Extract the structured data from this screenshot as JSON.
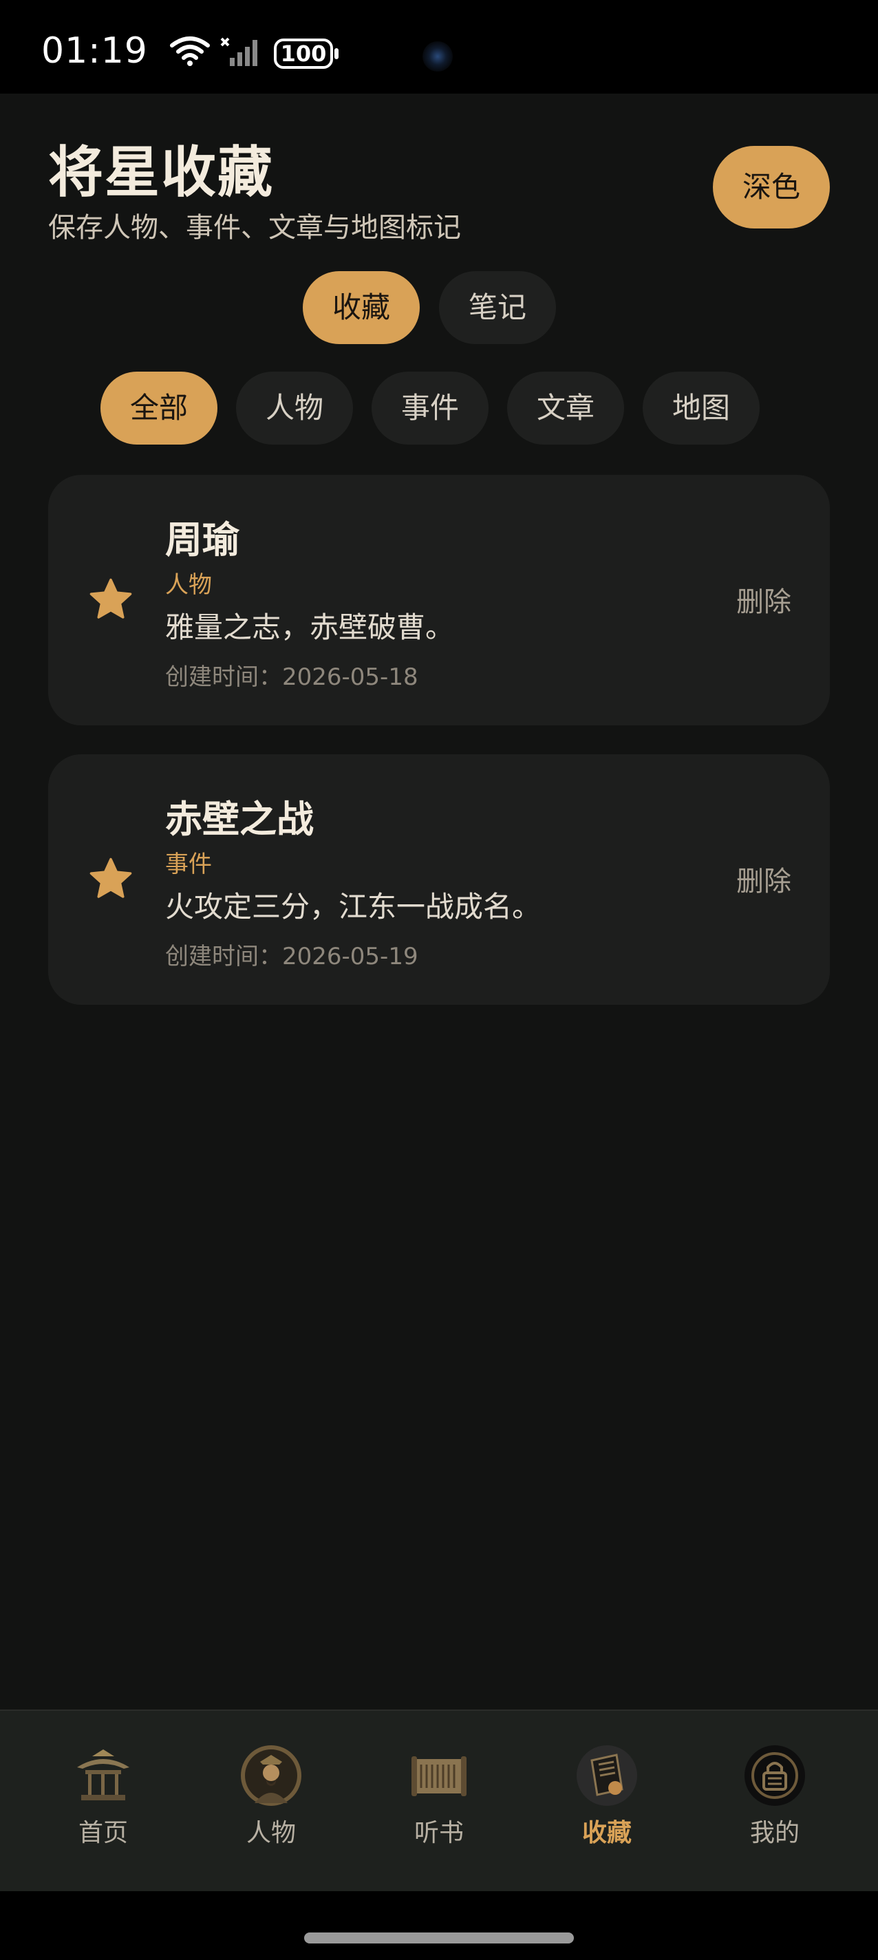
{
  "status_bar": {
    "time": "01:19",
    "battery": "100"
  },
  "header": {
    "title": "将星收藏",
    "subtitle": "保存人物、事件、文章与地图标记",
    "theme_button": "深色"
  },
  "tabs": [
    {
      "label": "收藏",
      "active": true
    },
    {
      "label": "笔记",
      "active": false
    }
  ],
  "filters": [
    {
      "label": "全部",
      "active": true
    },
    {
      "label": "人物",
      "active": false
    },
    {
      "label": "事件",
      "active": false
    },
    {
      "label": "文章",
      "active": false
    },
    {
      "label": "地图",
      "active": false
    }
  ],
  "favorites": [
    {
      "title": "周瑜",
      "category": "人物",
      "description": "雅量之志，赤壁破曹。",
      "created": "创建时间：2026-05-18",
      "delete_label": "删除"
    },
    {
      "title": "赤壁之战",
      "category": "事件",
      "description": "火攻定三分，江东一战成名。",
      "created": "创建时间：2026-05-19",
      "delete_label": "删除"
    }
  ],
  "bottom_nav": [
    {
      "label": "首页",
      "icon": "pavilion-icon",
      "active": false
    },
    {
      "label": "人物",
      "icon": "portrait-icon",
      "active": false
    },
    {
      "label": "听书",
      "icon": "scroll-icon",
      "active": false
    },
    {
      "label": "收藏",
      "icon": "book-icon",
      "active": true
    },
    {
      "label": "我的",
      "icon": "lock-badge-icon",
      "active": false
    }
  ],
  "colors": {
    "accent": "#d9a257",
    "background": "#121312",
    "card": "#1d1e1d"
  }
}
